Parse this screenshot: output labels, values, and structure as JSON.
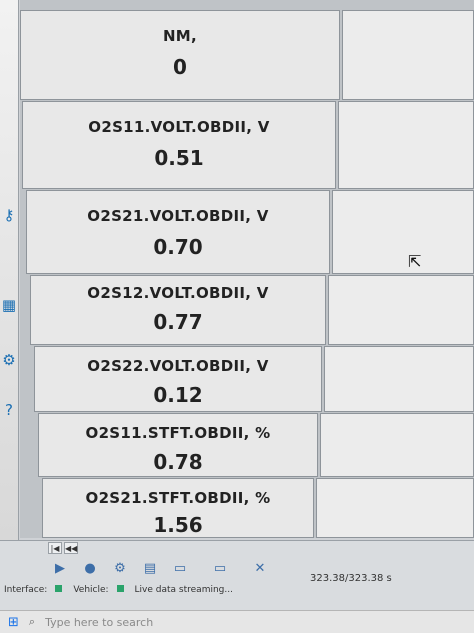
{
  "rows": [
    {
      "label": "NM,",
      "value": "0"
    },
    {
      "label": "O2S11.VOLT.OBDII, V",
      "value": "0.51"
    },
    {
      "label": "O2S21.VOLT.OBDII, V",
      "value": "0.70"
    },
    {
      "label": "O2S12.VOLT.OBDII, V",
      "value": "0.77"
    },
    {
      "label": "O2S22.VOLT.OBDII, V",
      "value": "0.12"
    },
    {
      "label": "O2S11.STFT.OBDII, %",
      "value": "0.78"
    },
    {
      "label": "O2S21.STFT.OBDII, %",
      "value": "1.56"
    }
  ],
  "status": {
    "interface_label": "Interface:",
    "vehicle_label": "Vehicle:",
    "streaming_text": "Live data streaming...",
    "counter": "323.38/323.38 s"
  },
  "scroll": {
    "first": "|◀",
    "prev": "◀◀"
  },
  "taskbar": {
    "search_placeholder": "Type here to search"
  },
  "icons": [
    "play-icon",
    "record-icon",
    "settings-icon",
    "save-icon",
    "folder-icon",
    "close-icon"
  ]
}
